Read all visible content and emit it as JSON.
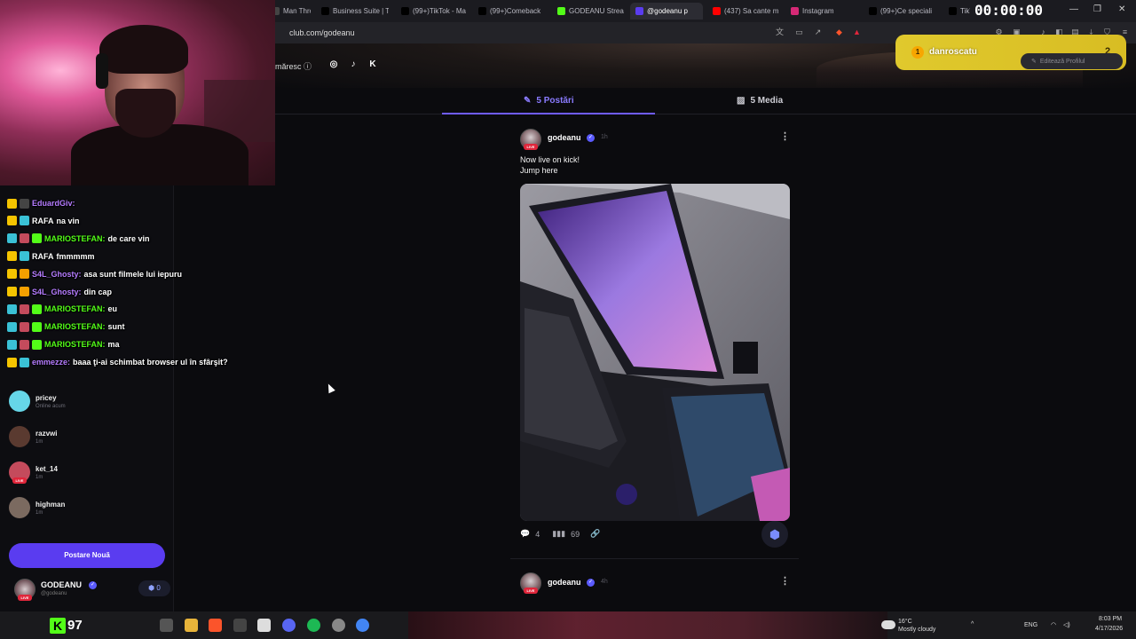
{
  "browser": {
    "tabs": [
      {
        "label": "Man Throw",
        "color": "#444"
      },
      {
        "label": "Business Suite | T",
        "color": "#000"
      },
      {
        "label": "(99+)TikTok - Ma",
        "color": "#000"
      },
      {
        "label": "(99+)Comeback",
        "color": "#000"
      },
      {
        "label": "GODEANU Strea",
        "color": "#53fc18"
      },
      {
        "label": "@godeanu p",
        "color": "#5a3cf0",
        "active": true
      },
      {
        "label": "(437) Sa cante m",
        "color": "#ff0000"
      },
      {
        "label": "Instagram",
        "color": "#d62976"
      },
      {
        "label": "(99+)Ce speciali",
        "color": "#000"
      },
      {
        "label": "TikT",
        "color": "#000"
      }
    ],
    "timer": "00:00:00",
    "url": "club.com/godeanu"
  },
  "profile_header": {
    "follow_text": "măresc ⓘ",
    "social_icons": [
      "instagram-icon",
      "tiktok-icon",
      "kick-icon"
    ]
  },
  "content_tabs": {
    "posts_label": "5 Postări",
    "media_label": "5 Media"
  },
  "posts": [
    {
      "user": "godeanu",
      "time": "1h",
      "live_label": "LIVE",
      "text_lines": [
        "Now live on kick!",
        "Jump here"
      ],
      "comments": "4",
      "views": "69"
    },
    {
      "user": "godeanu",
      "time": "4h",
      "live_label": "LIVE"
    }
  ],
  "sidebar": {
    "followers": [
      {
        "name": "pricey",
        "status": "Online acum",
        "color": "#66d6e8"
      },
      {
        "name": "razvwi",
        "status": "1m",
        "color": "#5a3a30"
      },
      {
        "name": "ket_14",
        "status": "1m",
        "color": "#c44b5c",
        "live": true
      },
      {
        "name": "highman",
        "status": "1m",
        "color": "#7b6a60"
      }
    ],
    "new_post_label": "Postare Nouă",
    "me": {
      "name": "GODEANU",
      "handle": "@godeanu",
      "badge": "0",
      "live_label": "LIVE"
    }
  },
  "chat": {
    "lines": [
      {
        "user": "EduardGiv:",
        "msg": "",
        "color": "purple",
        "badges": [
          "#f5c400",
          "#444"
        ]
      },
      {
        "user": "RAFA",
        "msg": "na vin",
        "color": "white",
        "badges": [
          "#f5c400",
          "#3ac1d6"
        ]
      },
      {
        "user": "MARIOSTEFAN:",
        "msg": "de care vin",
        "color": "green",
        "badges": [
          "#3ac1d6",
          "#c44b5c",
          "#53fc18"
        ]
      },
      {
        "user": "RAFA",
        "msg": "fmmmmm",
        "color": "white",
        "badges": [
          "#f5c400",
          "#3ac1d6"
        ]
      },
      {
        "user": "S4L_Ghosty:",
        "msg": "asa sunt filmele lui iepuru",
        "color": "purple",
        "badges": [
          "#f5c400",
          "#f5a000"
        ]
      },
      {
        "user": "S4L_Ghosty:",
        "msg": "din cap",
        "color": "purple",
        "badges": [
          "#f5c400",
          "#f5a000"
        ]
      },
      {
        "user": "MARIOSTEFAN:",
        "msg": "eu",
        "color": "green",
        "badges": [
          "#3ac1d6",
          "#c44b5c",
          "#53fc18"
        ]
      },
      {
        "user": "MARIOSTEFAN:",
        "msg": "sunt",
        "color": "green",
        "badges": [
          "#3ac1d6",
          "#c44b5c",
          "#53fc18"
        ]
      },
      {
        "user": "MARIOSTEFAN:",
        "msg": "ma",
        "color": "green",
        "badges": [
          "#3ac1d6",
          "#c44b5c",
          "#53fc18"
        ]
      },
      {
        "user": "emmezze:",
        "msg": "baaa ţi-ai schimbat browser ul în sfârşit?",
        "color": "purple",
        "badges": [
          "#f5c400",
          "#3ac1d6"
        ]
      }
    ]
  },
  "overlay": {
    "username": "danroscatu",
    "count": "2",
    "coin": "1",
    "edit_profile_label": "Editează Profilul"
  },
  "taskbar": {
    "stream_count": "97",
    "weather_temp": "16°C",
    "weather_desc": "Mostly cloudy",
    "lang": "ENG",
    "time": "8:03 PM",
    "date": "4/17/2026"
  }
}
